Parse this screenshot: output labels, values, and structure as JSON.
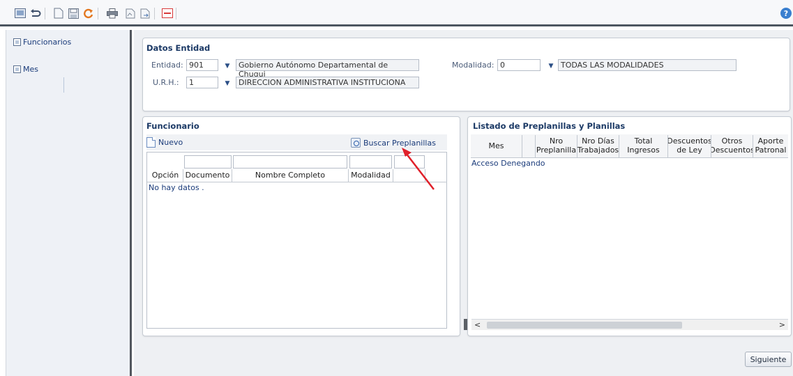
{
  "toolbar": {
    "buttons": [
      {
        "name": "print-preview-icon"
      },
      {
        "name": "undo-icon"
      },
      {
        "name": "new-document-icon"
      },
      {
        "name": "save-icon"
      },
      {
        "name": "refresh-icon"
      },
      {
        "name": "print-icon"
      },
      {
        "name": "report-icon"
      },
      {
        "name": "export-icon"
      },
      {
        "name": "toggle-icon"
      }
    ],
    "help": "?"
  },
  "nav": {
    "items": [
      {
        "label": "Funcionarios"
      },
      {
        "label": "Mes"
      }
    ]
  },
  "datos_entidad": {
    "title": "Datos Entidad",
    "entidad_label": "Entidad:",
    "entidad_code": "901",
    "entidad_name": "Gobierno Autónomo Departamental de Chuqui",
    "urh_label": "U.R.H.:",
    "urh_code": "1",
    "urh_name": "DIRECCION ADMINISTRATIVA INSTITUCIONA",
    "modalidad_label": "Modalidad:",
    "modalidad_code": "0",
    "modalidad_name": "TODAS LAS MODALIDADES"
  },
  "funcionario": {
    "title": "Funcionario",
    "nuevo": "Nuevo",
    "buscar": "Buscar Preplanillas",
    "columns": [
      "Opción",
      "Documento",
      "Nombre Completo",
      "Modalidad"
    ],
    "empty": "No hay datos ."
  },
  "listado": {
    "title": "Listado de Preplanillas y Planillas",
    "columns": [
      {
        "line1": "Mes",
        "line2": ""
      },
      {
        "line1": "",
        "line2": ""
      },
      {
        "line1": "Nro",
        "line2": "Preplanilla"
      },
      {
        "line1": "Nro Días",
        "line2": "Trabajados"
      },
      {
        "line1": "Total",
        "line2": "Ingresos"
      },
      {
        "line1": "Descuentos",
        "line2": "de Ley"
      },
      {
        "line1": "Otros",
        "line2": "Descuentos"
      },
      {
        "line1": "Aporte",
        "line2": "Patronal"
      }
    ],
    "message": "Acceso Denegando",
    "scroll_left": "<",
    "scroll_right": ">"
  },
  "footer": {
    "siguiente": "Siguiente"
  },
  "colors": {
    "accent": "#1c3a66",
    "toolbar_border": "#4d5660",
    "arrow": "#e0202a"
  }
}
